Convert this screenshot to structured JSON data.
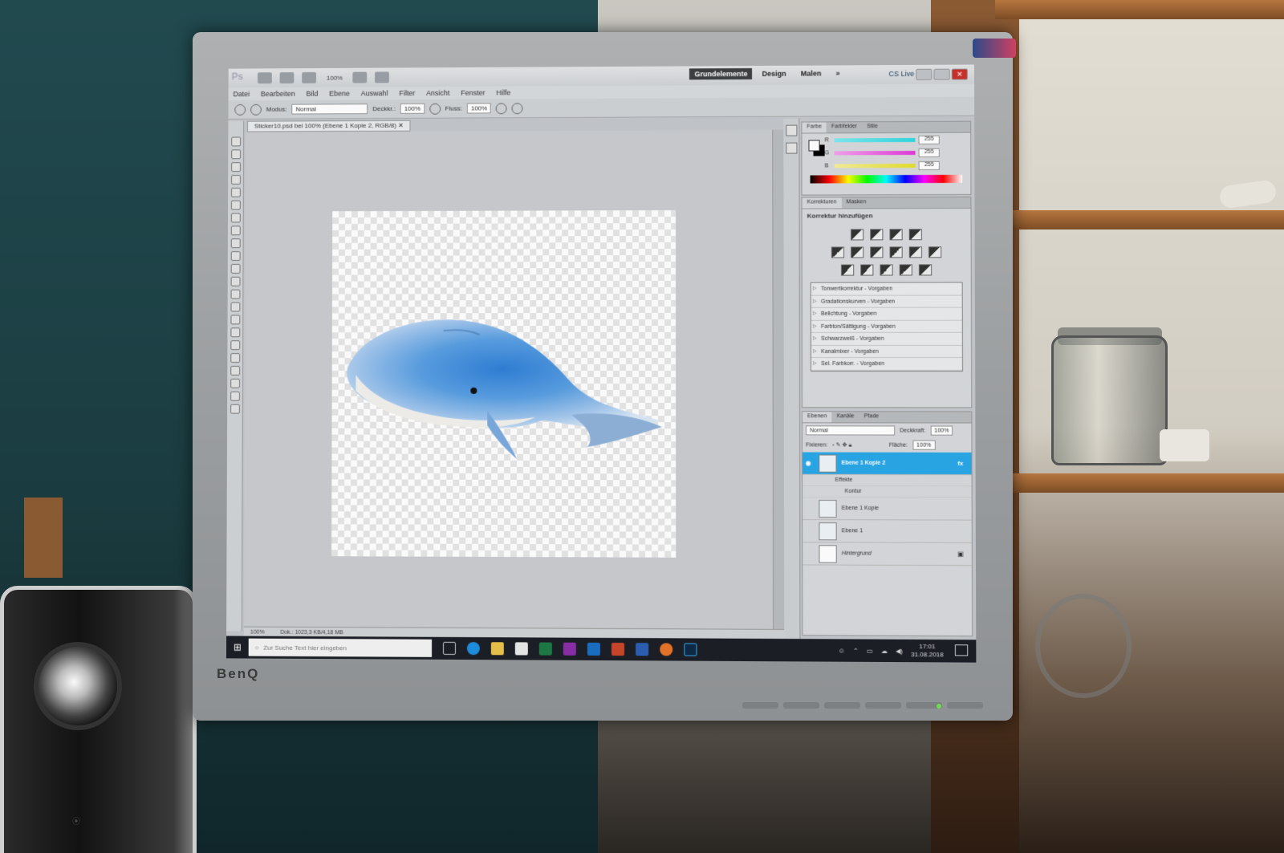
{
  "app": {
    "logo": "Ps",
    "zoom": "100%",
    "workspaces": [
      "Grundelemente",
      "Design",
      "Malen"
    ],
    "workspace_more": "»",
    "cslive": "CS Live",
    "close_glyph": "✕"
  },
  "menu": [
    "Datei",
    "Bearbeiten",
    "Bild",
    "Ebene",
    "Auswahl",
    "Filter",
    "Ansicht",
    "Fenster",
    "Hilfe"
  ],
  "options": {
    "modus_label": "Modus:",
    "modus_value": "Normal",
    "deckkr_label": "Deckkr.:",
    "deckkr_value": "100%",
    "fluss_label": "Fluss:",
    "fluss_value": "100%"
  },
  "document": {
    "tab_title": "Sticker10.psd bei 100% (Ebene 1 Kopie 2, RGB/8)",
    "status_zoom": "100%",
    "status_doc": "Dok.: 1023,3 KB/4,18 MB"
  },
  "color_panel": {
    "tabs": [
      "Farbe",
      "Farbfelder",
      "Stile"
    ],
    "channels": [
      {
        "label": "R",
        "value": "255",
        "color": "#2fd8e0"
      },
      {
        "label": "G",
        "value": "255",
        "color": "#e23ad8"
      },
      {
        "label": "B",
        "value": "255",
        "color": "#e6df2c"
      }
    ]
  },
  "adjust_panel": {
    "tabs": [
      "Korrekturen",
      "Masken"
    ],
    "title": "Korrektur hinzufügen",
    "presets": [
      "Tonwertkorrektur - Vorgaben",
      "Gradationskurven - Vorgaben",
      "Belichtung - Vorgaben",
      "Farbton/Sättigung - Vorgaben",
      "Schwarzweiß - Vorgaben",
      "Kanalmixer - Vorgaben",
      "Sel. Farbkorr. - Vorgaben"
    ]
  },
  "layers_panel": {
    "tabs": [
      "Ebenen",
      "Kanäle",
      "Pfade"
    ],
    "blend_mode": "Normal",
    "opacity_label": "Deckkraft:",
    "opacity_value": "100%",
    "lock_label": "Fixieren:",
    "fill_label": "Fläche:",
    "fill_value": "100%",
    "layers": [
      {
        "name": "Ebene 1 Kopie 2",
        "selected": true
      },
      {
        "name": "Ebene 1 Kopie",
        "selected": false
      },
      {
        "name": "Ebene 1",
        "selected": false
      },
      {
        "name": "Hintergrund",
        "selected": false
      }
    ],
    "effects_label": "Effekte",
    "effect_stroke": "Kontur"
  },
  "taskbar": {
    "search_placeholder": "Zur Suche Text hier eingeben",
    "time": "17:01",
    "date": "31.08.2018"
  },
  "monitor": {
    "brand": "BenQ"
  },
  "accent": "#2aa7e8"
}
